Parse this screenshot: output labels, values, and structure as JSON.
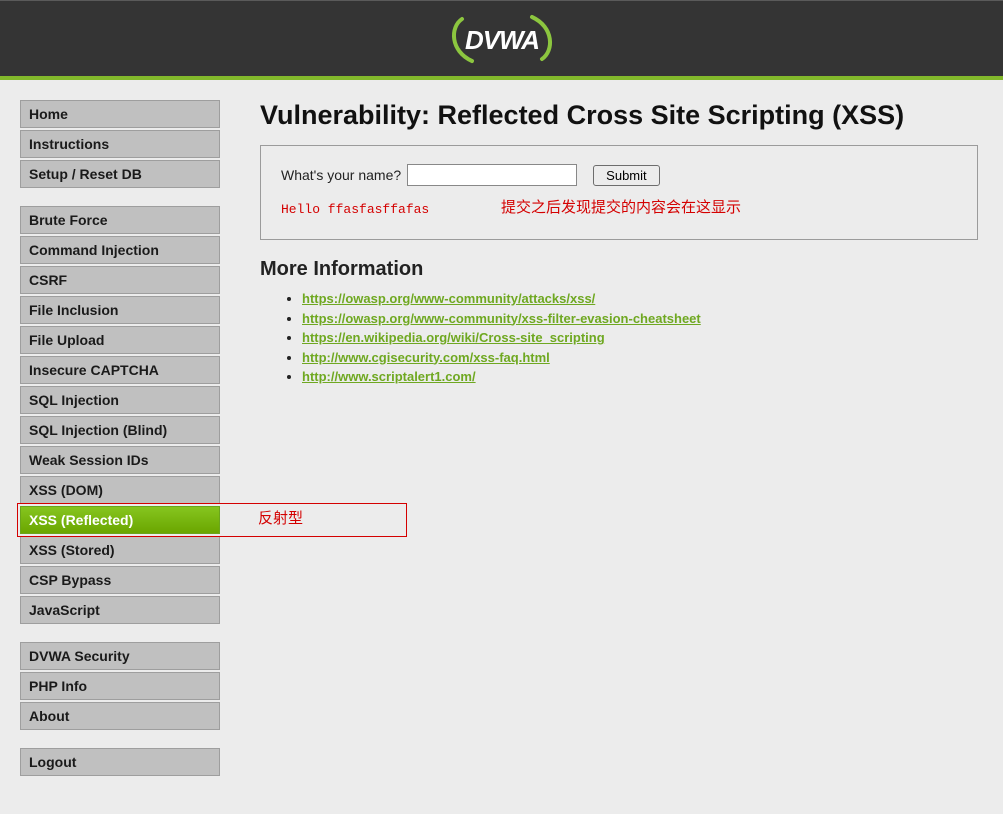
{
  "header": {
    "logo_text": "DVWA"
  },
  "sidebar": {
    "groups": [
      {
        "items": [
          {
            "label": "Home",
            "selected": false
          },
          {
            "label": "Instructions",
            "selected": false
          },
          {
            "label": "Setup / Reset DB",
            "selected": false
          }
        ]
      },
      {
        "items": [
          {
            "label": "Brute Force",
            "selected": false
          },
          {
            "label": "Command Injection",
            "selected": false
          },
          {
            "label": "CSRF",
            "selected": false
          },
          {
            "label": "File Inclusion",
            "selected": false
          },
          {
            "label": "File Upload",
            "selected": false
          },
          {
            "label": "Insecure CAPTCHA",
            "selected": false
          },
          {
            "label": "SQL Injection",
            "selected": false
          },
          {
            "label": "SQL Injection (Blind)",
            "selected": false
          },
          {
            "label": "Weak Session IDs",
            "selected": false
          },
          {
            "label": "XSS (DOM)",
            "selected": false
          },
          {
            "label": "XSS (Reflected)",
            "selected": true
          },
          {
            "label": "XSS (Stored)",
            "selected": false
          },
          {
            "label": "CSP Bypass",
            "selected": false
          },
          {
            "label": "JavaScript",
            "selected": false
          }
        ]
      },
      {
        "items": [
          {
            "label": "DVWA Security",
            "selected": false
          },
          {
            "label": "PHP Info",
            "selected": false
          },
          {
            "label": "About",
            "selected": false
          }
        ]
      },
      {
        "items": [
          {
            "label": "Logout",
            "selected": false
          }
        ]
      }
    ]
  },
  "main": {
    "title": "Vulnerability: Reflected Cross Site Scripting (XSS)",
    "form": {
      "prompt": "What's your name?",
      "input_value": "",
      "submit_label": "Submit",
      "output": "Hello ffasfasffafas",
      "note": "提交之后发现提交的内容会在这显示"
    },
    "more_info_heading": "More Information",
    "links": [
      "https://owasp.org/www-community/attacks/xss/",
      "https://owasp.org/www-community/xss-filter-evasion-cheatsheet",
      "https://en.wikipedia.org/wiki/Cross-site_scripting",
      "http://www.cgisecurity.com/xss-faq.html",
      "http://www.scriptalert1.com/"
    ]
  },
  "annotation": {
    "label": "反射型"
  }
}
